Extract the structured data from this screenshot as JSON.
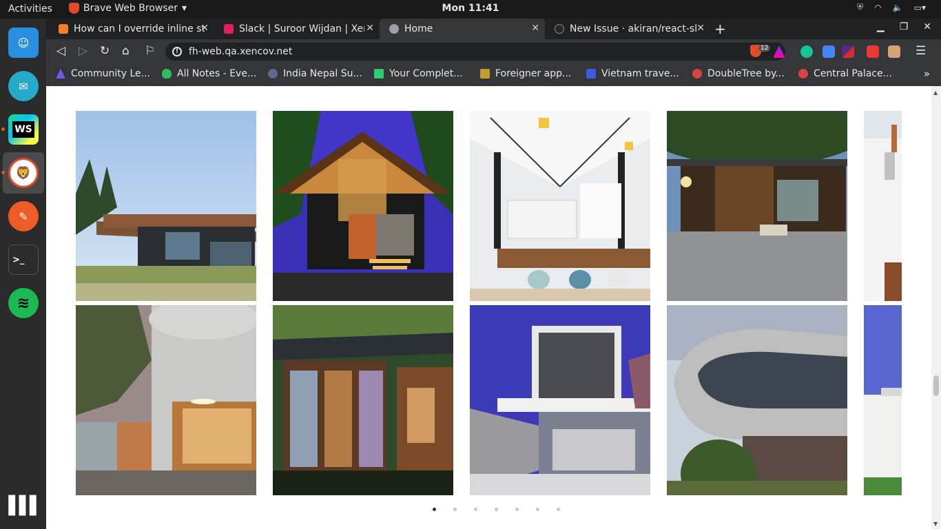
{
  "topbar": {
    "activities": "Activities",
    "app_name": "Brave Web Browser",
    "clock": "Mon 11:41"
  },
  "dock": {
    "items": [
      {
        "name": "finder-icon",
        "color": "#2a8fe0",
        "glyph": "☺"
      },
      {
        "name": "mail-icon",
        "color": "#27a9c9",
        "glyph": "✉"
      },
      {
        "name": "webstorm-icon",
        "color": "#1a1a1a",
        "glyph": "WS"
      },
      {
        "name": "brave-icon",
        "color": "#ffffff",
        "glyph": "🦁"
      },
      {
        "name": "postman-icon",
        "color": "#ef5b25",
        "glyph": "✎"
      },
      {
        "name": "terminal-icon",
        "color": "#2c2c2c",
        "glyph": ">_"
      },
      {
        "name": "spotify-icon",
        "color": "#1db954",
        "glyph": "≋"
      },
      {
        "name": "app-grid-icon",
        "color": "#2b2b2b",
        "glyph": "⋮⋮⋮"
      }
    ]
  },
  "tabs": [
    {
      "title": "How can I override inline st",
      "favicon_color": "#f48024"
    },
    {
      "title": "Slack | Suroor Wijdan | Xenc",
      "favicon_color": "#e01e5a"
    },
    {
      "title": "Home",
      "favicon_color": "#9aa0a6"
    },
    {
      "title": "New Issue · akiran/react-sli",
      "favicon_color": "#24292e"
    }
  ],
  "address": {
    "url": "fh-web.qa.xencov.net",
    "shield_count": "12"
  },
  "bookmarks": [
    {
      "label": "Community Le...",
      "color": "#6c5ce7"
    },
    {
      "label": "All Notes - Eve...",
      "color": "#2dbe60"
    },
    {
      "label": "India Nepal Su...",
      "color": "#5b6b8a"
    },
    {
      "label": "Your Complet...",
      "color": "#2ecc71"
    },
    {
      "label": "Foreigner app...",
      "color": "#c59b2e"
    },
    {
      "label": "Vietnam trave...",
      "color": "#3b5bdb"
    },
    {
      "label": "DoubleTree by...",
      "color": "#d64545"
    },
    {
      "label": "Central Palace...",
      "color": "#d64545"
    }
  ],
  "gallery": {
    "items": [
      {
        "name": "modern-cabin-meadow"
      },
      {
        "name": "timber-lodge-dusk"
      },
      {
        "name": "white-kitchen-interior"
      },
      {
        "name": "wood-slat-house-night"
      },
      {
        "name": "white-facade-partial"
      },
      {
        "name": "silo-house"
      },
      {
        "name": "glass-pavilion-forest"
      },
      {
        "name": "cantilever-box-house"
      },
      {
        "name": "curved-concrete-house"
      },
      {
        "name": "white-house-partial"
      }
    ],
    "dots": 7,
    "active_dot": 0
  }
}
